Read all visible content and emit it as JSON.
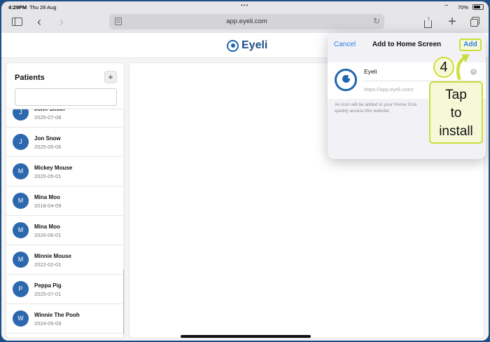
{
  "status_bar": {
    "time": "4:29PM",
    "date": "Thu 28 Aug",
    "battery": "70%"
  },
  "browser": {
    "url": "app.eyeli.com"
  },
  "app": {
    "brand": "Eyeli"
  },
  "sidebar": {
    "title": "Patients",
    "add_label": "+",
    "search_value": "",
    "search_placeholder": "",
    "patients": [
      {
        "initial": "J",
        "name": "John Smith",
        "date": "2025-07-08"
      },
      {
        "initial": "J",
        "name": "Jon Snow",
        "date": "2025-05-06"
      },
      {
        "initial": "M",
        "name": "Mickey Mouse",
        "date": "2025-05-01"
      },
      {
        "initial": "M",
        "name": "Mina Moo",
        "date": "2018-04-09"
      },
      {
        "initial": "M",
        "name": "Mina Moo",
        "date": "2020-06-01"
      },
      {
        "initial": "M",
        "name": "Minnie Mouse",
        "date": "2022-02-01"
      },
      {
        "initial": "P",
        "name": "Peppa Pig",
        "date": "2025-07-01"
      },
      {
        "initial": "W",
        "name": "Winnie The Pooh",
        "date": "2024-05-09"
      }
    ]
  },
  "sheet": {
    "cancel_label": "Cancel",
    "title": "Add to Home Screen",
    "add_label": "Add",
    "app_name": "Eyeli",
    "app_url": "https://app.eyeli.com/",
    "description": "An icon will be added to your Home Scre\nquickly access this website."
  },
  "tutorial": {
    "step_number": "4",
    "callout_text": "Tap\nto\ninstall",
    "accent_color": "#c9de3c",
    "fill_color": "#f6f9d8"
  },
  "colors": {
    "primary": "#1f66b0",
    "link": "#2f7be8",
    "avatar": "#2b68ae"
  }
}
